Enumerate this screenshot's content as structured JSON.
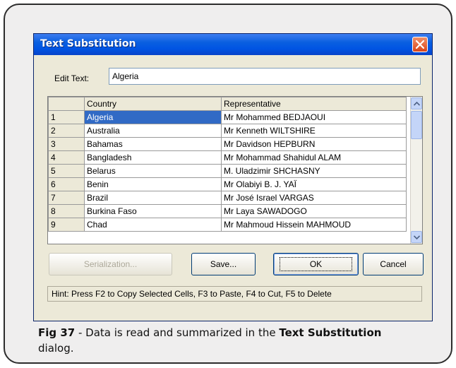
{
  "dialog": {
    "title": "Text Substitution",
    "edit_label": "Edit Text:",
    "edit_value": "Algeria"
  },
  "grid": {
    "columns": [
      "",
      "Country",
      "Representative"
    ],
    "rows": [
      {
        "num": "1",
        "country": "Algeria",
        "rep": "Mr Mohammed BEDJAOUI"
      },
      {
        "num": "2",
        "country": "Australia",
        "rep": "Mr Kenneth WILTSHIRE"
      },
      {
        "num": "3",
        "country": "Bahamas",
        "rep": "Mr Davidson HEPBURN"
      },
      {
        "num": "4",
        "country": "Bangladesh",
        "rep": "Mr Mohammad Shahidul ALAM"
      },
      {
        "num": "5",
        "country": "Belarus",
        "rep": "M. Uladzimir SHCHASNY"
      },
      {
        "num": "6",
        "country": "Benin",
        "rep": "Mr Olabiyi B. J. YAÏ"
      },
      {
        "num": "7",
        "country": "Brazil",
        "rep": "Mr José Israel VARGAS"
      },
      {
        "num": "8",
        "country": "Burkina Faso",
        "rep": "Mr Laya SAWADOGO"
      },
      {
        "num": "9",
        "country": "Chad",
        "rep": "Mr Mahmoud Hissein MAHMOUD"
      }
    ]
  },
  "buttons": {
    "serialization": "Serialization...",
    "save": "Save...",
    "ok": "OK",
    "cancel": "Cancel"
  },
  "hint": "Hint: Press F2 to Copy Selected Cells, F3 to Paste, F4 to Cut, F5 to Delete",
  "caption": {
    "fig": "Fig 37",
    "text1": " - Data is read and summarized in the ",
    "bold": "Text Substitution",
    "text2": " dialog."
  },
  "icons": {
    "close": "close-icon",
    "scroll_up": "scroll-up-icon",
    "scroll_down": "scroll-down-icon"
  }
}
